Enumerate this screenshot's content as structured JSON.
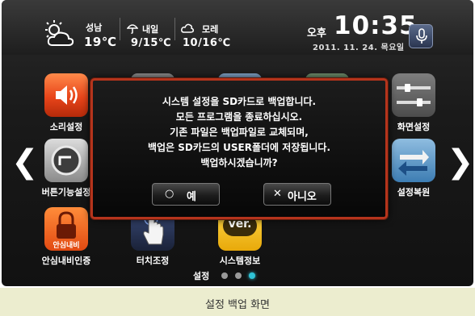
{
  "weather": {
    "today": {
      "place": "성남",
      "temp": "19℃"
    },
    "tomorrow": {
      "label": "내일",
      "temp": "9/15℃"
    },
    "dayafter": {
      "label": "모레",
      "temp": "10/16℃"
    }
  },
  "clock": {
    "ampm": "오후",
    "time": "10:35",
    "date": "2011. 11. 24. 목요일"
  },
  "apps": {
    "sound": "소리설정",
    "screen": "화면설정",
    "button": "버튼기능설정",
    "restore": "설정복원",
    "security": "안심내비인증",
    "touch": "터치조정",
    "sysinfo": "시스템정보",
    "security_badge": "안심내비",
    "ver_badge": "ver."
  },
  "pager": {
    "label": "설정",
    "pages": 3,
    "active": 3
  },
  "dialog": {
    "lines": [
      "시스템 설정을 SD카드로 백업합니다.",
      "모든 프로그램을 종료하십시오.",
      "기존 파일은 백업파일로 교체되며,",
      "백업은 SD카드의 USER폴더에 저장됩니다.",
      "백업하시겠습니까?"
    ],
    "yes_label": "예",
    "no_label": "아니오"
  },
  "caption": "설정 백업 화면",
  "colors": {
    "dialog_border": "#b5341c",
    "pager_active": "#2fc3d6",
    "caption_bg": "#ecedcf"
  }
}
